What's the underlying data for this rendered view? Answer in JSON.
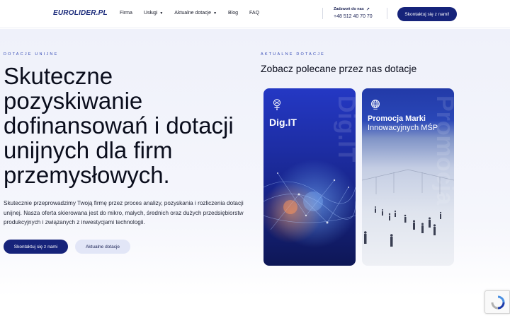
{
  "header": {
    "logo": "EUROLIDER.PL",
    "nav": [
      {
        "label": "Firma",
        "has_dropdown": false
      },
      {
        "label": "Usługi",
        "has_dropdown": true
      },
      {
        "label": "Aktualne dotacje",
        "has_dropdown": true
      },
      {
        "label": "Blog",
        "has_dropdown": false
      },
      {
        "label": "FAQ",
        "has_dropdown": false
      }
    ],
    "call_label": "Zadzwoń do nas",
    "call_icon": "arrow-up-right-icon",
    "phone": "+48 512 40 70 70",
    "cta": "Skontaktuj się z nami!"
  },
  "hero": {
    "eyebrow": "DOTACJE UNIJNE",
    "title": "Skuteczne pozyskiwanie dofinansowań i dotacji unijnych dla firm przemysłowych.",
    "description": "Skutecznie przeprowadzimy Twoją firmę przez proces analizy, pozyskania i rozliczenia dotacji unijnej. Nasza oferta skierowana jest do mikro, małych, średnich oraz dużych przedsiębiorstw produkcyjnych i związanych z inwestycjami technologii.",
    "primary_button": "Skontaktuj się z nami",
    "secondary_button": "Aktualne dotacje"
  },
  "featured": {
    "eyebrow": "AKTUALNE DOTACJE",
    "title": "Zobacz polecane przez nas dotacje",
    "cards": [
      {
        "title": "Dig.IT",
        "icon": "digital-brain-icon",
        "watermark": "Dig.IT"
      },
      {
        "title": "Promocja Marki",
        "subtitle": "Innowacyjnych MŚP",
        "icon": "globe-icon",
        "watermark": "Promocja"
      }
    ]
  },
  "colors": {
    "brand_navy": "#16237a",
    "accent_blue": "#3147b3",
    "secondary_button_bg": "#e2e6f7"
  }
}
